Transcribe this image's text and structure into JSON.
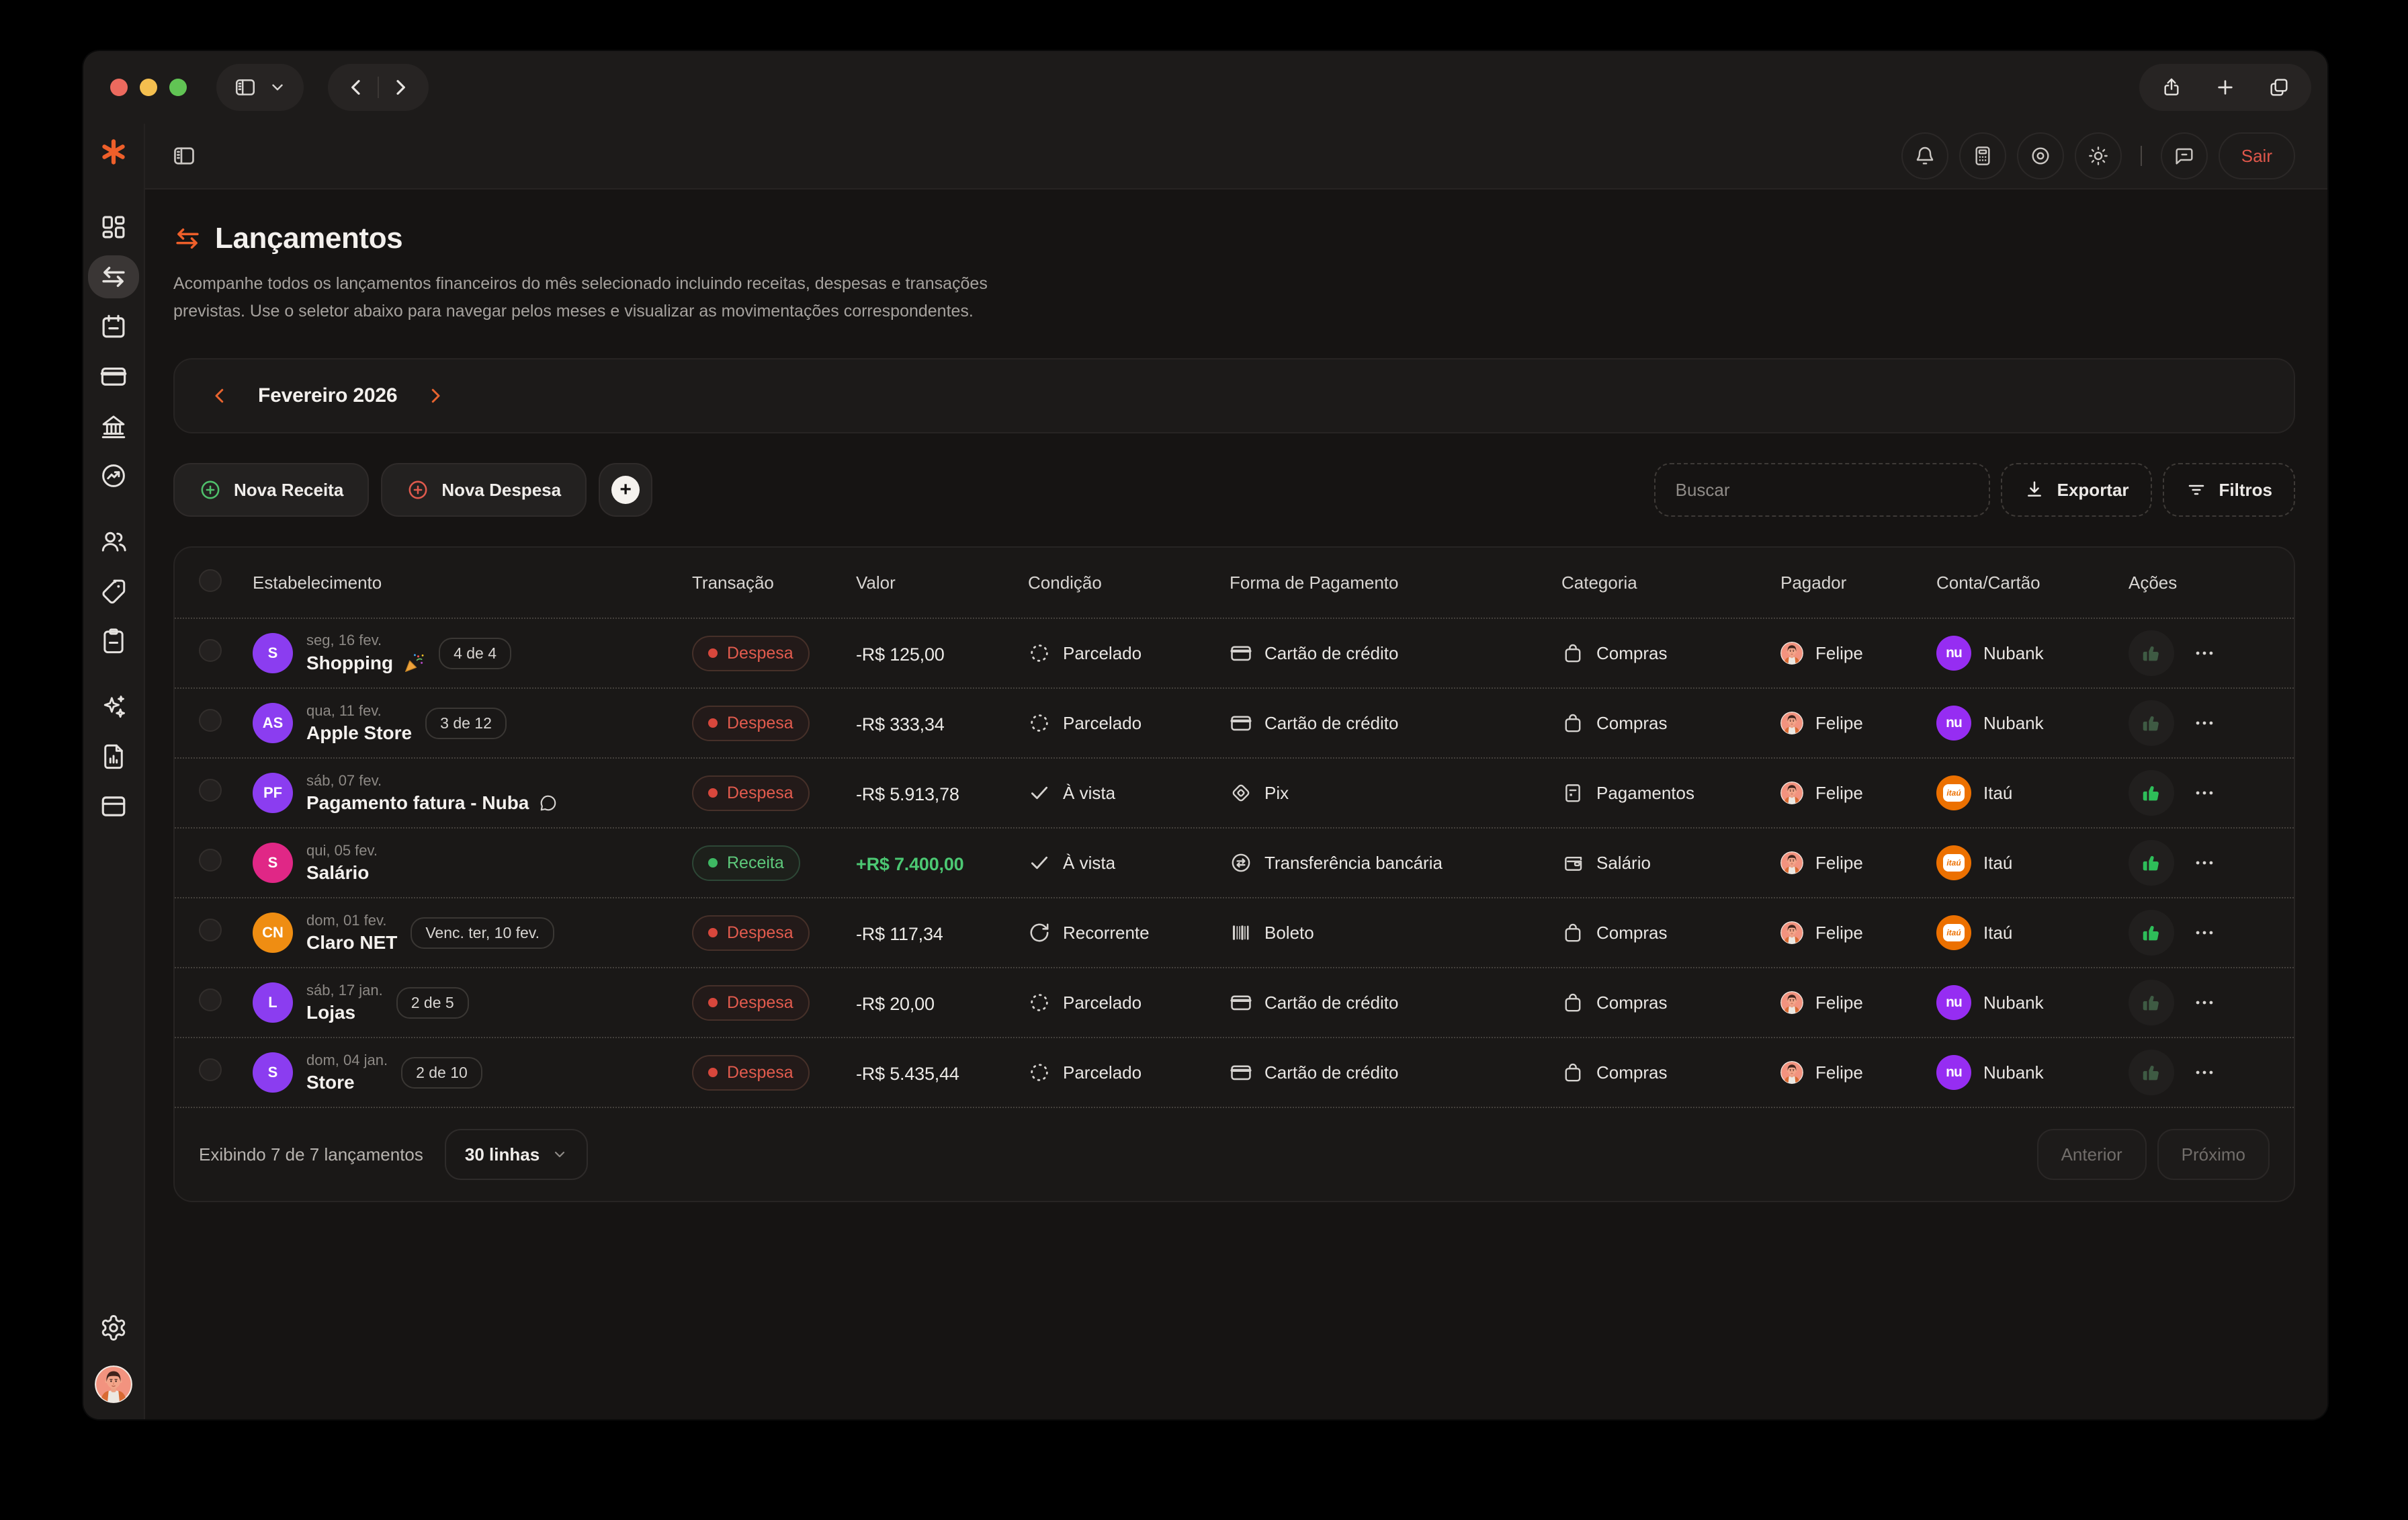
{
  "topbar": {
    "icons": [
      {
        "id": "notifications",
        "icon": "bell"
      },
      {
        "id": "calculator",
        "icon": "calculator"
      },
      {
        "id": "visibility",
        "icon": "eye"
      },
      {
        "id": "theme",
        "icon": "sun"
      },
      {
        "id": "divider"
      },
      {
        "id": "feedback",
        "icon": "message"
      }
    ],
    "logout_label": "Sair"
  },
  "sidebar": {
    "logo_icon": "asterisk-logo",
    "items": [
      {
        "id": "dashboard",
        "icon": "layout-dashboard",
        "active": false
      },
      {
        "id": "transactions",
        "icon": "transfer-arrows",
        "active": true
      },
      {
        "id": "calendar",
        "icon": "calendar",
        "active": false
      },
      {
        "id": "cards",
        "icon": "credit-card",
        "active": false
      },
      {
        "id": "bank-accounts",
        "icon": "bank",
        "active": false
      },
      {
        "id": "performance",
        "icon": "trend-circle",
        "active": false
      },
      {
        "id": "members",
        "icon": "users",
        "active": false,
        "new_group": true
      },
      {
        "id": "tags",
        "icon": "tag",
        "active": false
      },
      {
        "id": "planner",
        "icon": "clipboard",
        "active": false
      },
      {
        "id": "ai-assistant",
        "icon": "sparkles",
        "active": false,
        "new_group": true
      },
      {
        "id": "reports",
        "icon": "file-chart",
        "active": false
      },
      {
        "id": "browser",
        "icon": "window",
        "active": false
      }
    ],
    "bottom": [
      {
        "id": "settings",
        "icon": "gear"
      },
      {
        "id": "profile",
        "icon": "user-avatar"
      }
    ]
  },
  "header": {
    "title": "Lançamentos",
    "title_icon": "transfer-arrows",
    "description": "Acompanhe todos os lançamentos financeiros do mês selecionado incluindo receitas, despesas e transações previstas. Use o seletor abaixo para navegar pelos meses e visualizar as movimentações correspondentes."
  },
  "month_selector": {
    "label": "Fevereiro 2026",
    "prev_icon": "chevron-left",
    "next_icon": "chevron-right"
  },
  "actions": {
    "new_income_label": "Nova Receita",
    "new_expense_label": "Nova Despesa",
    "add_label": "+",
    "search_placeholder": "Buscar",
    "export_label": "Exportar",
    "filters_label": "Filtros"
  },
  "table": {
    "columns": [
      "Estabelecimento",
      "Transação",
      "Valor",
      "Condição",
      "Forma de Pagamento",
      "Categoria",
      "Pagador",
      "Conta/Cartão",
      "Ações"
    ],
    "rows": [
      {
        "initials": "S",
        "avatar_color": "#8b3df0",
        "date": "seg, 16 fev.",
        "name": "Shopping",
        "decorations": [
          "party"
        ],
        "badge": "4 de 4",
        "type": {
          "label": "Despesa",
          "kind": "expense"
        },
        "value": "-R$ 125,00",
        "value_kind": "negative",
        "condition": {
          "label": "Parcelado",
          "icon": "installments"
        },
        "payment": {
          "label": "Cartão de crédito",
          "icon": "credit-card"
        },
        "category": {
          "label": "Compras",
          "icon": "shopping-bag"
        },
        "payer": "Felipe",
        "account": {
          "label": "Nubank",
          "bank": "nubank"
        },
        "paid": false
      },
      {
        "initials": "AS",
        "avatar_color": "#8b3df0",
        "date": "qua, 11 fev.",
        "name": "Apple Store",
        "decorations": [],
        "badge": "3 de 12",
        "type": {
          "label": "Despesa",
          "kind": "expense"
        },
        "value": "-R$ 333,34",
        "value_kind": "negative",
        "condition": {
          "label": "Parcelado",
          "icon": "installments"
        },
        "payment": {
          "label": "Cartão de crédito",
          "icon": "credit-card"
        },
        "category": {
          "label": "Compras",
          "icon": "shopping-bag"
        },
        "payer": "Felipe",
        "account": {
          "label": "Nubank",
          "bank": "nubank"
        },
        "paid": false
      },
      {
        "initials": "PF",
        "avatar_color": "#8b3df0",
        "date": "sáb, 07 fev.",
        "name": "Pagamento fatura - Nuba",
        "decorations": [
          "comment"
        ],
        "badge": null,
        "type": {
          "label": "Despesa",
          "kind": "expense"
        },
        "value": "-R$ 5.913,78",
        "value_kind": "negative",
        "condition": {
          "label": "À vista",
          "icon": "check"
        },
        "payment": {
          "label": "Pix",
          "icon": "pix"
        },
        "category": {
          "label": "Pagamentos",
          "icon": "receipt"
        },
        "payer": "Felipe",
        "account": {
          "label": "Itaú",
          "bank": "itau"
        },
        "paid": true
      },
      {
        "initials": "S",
        "avatar_color": "#e02786",
        "date": "qui, 05 fev.",
        "name": "Salário",
        "decorations": [],
        "badge": null,
        "type": {
          "label": "Receita",
          "kind": "income"
        },
        "value": "+R$ 7.400,00",
        "value_kind": "positive",
        "condition": {
          "label": "À vista",
          "icon": "check"
        },
        "payment": {
          "label": "Transferência bancária",
          "icon": "bank-transfer"
        },
        "category": {
          "label": "Salário",
          "icon": "wallet"
        },
        "payer": "Felipe",
        "account": {
          "label": "Itaú",
          "bank": "itau"
        },
        "paid": true
      },
      {
        "initials": "CN",
        "avatar_color": "#ef8d12",
        "date": "dom, 01 fev.",
        "name": "Claro NET",
        "decorations": [],
        "badge": "Venc. ter, 10 fev.",
        "type": {
          "label": "Despesa",
          "kind": "expense"
        },
        "value": "-R$ 117,34",
        "value_kind": "negative",
        "condition": {
          "label": "Recorrente",
          "icon": "recurring"
        },
        "payment": {
          "label": "Boleto",
          "icon": "barcode"
        },
        "category": {
          "label": "Compras",
          "icon": "shopping-bag"
        },
        "payer": "Felipe",
        "account": {
          "label": "Itaú",
          "bank": "itau"
        },
        "paid": true
      },
      {
        "initials": "L",
        "avatar_color": "#8b3df0",
        "date": "sáb, 17 jan.",
        "name": "Lojas",
        "decorations": [],
        "badge": "2 de 5",
        "type": {
          "label": "Despesa",
          "kind": "expense"
        },
        "value": "-R$ 20,00",
        "value_kind": "negative",
        "condition": {
          "label": "Parcelado",
          "icon": "installments"
        },
        "payment": {
          "label": "Cartão de crédito",
          "icon": "credit-card"
        },
        "category": {
          "label": "Compras",
          "icon": "shopping-bag"
        },
        "payer": "Felipe",
        "account": {
          "label": "Nubank",
          "bank": "nubank"
        },
        "paid": false
      },
      {
        "initials": "S",
        "avatar_color": "#8b3df0",
        "date": "dom, 04 jan.",
        "name": "Store",
        "decorations": [],
        "badge": "2 de 10",
        "type": {
          "label": "Despesa",
          "kind": "expense"
        },
        "value": "-R$ 5.435,44",
        "value_kind": "negative",
        "condition": {
          "label": "Parcelado",
          "icon": "installments"
        },
        "payment": {
          "label": "Cartão de crédito",
          "icon": "credit-card"
        },
        "category": {
          "label": "Compras",
          "icon": "shopping-bag"
        },
        "payer": "Felipe",
        "account": {
          "label": "Nubank",
          "bank": "nubank"
        },
        "paid": false
      }
    ]
  },
  "footer": {
    "summary": "Exibindo 7 de 7 lançamentos",
    "rows_per_page": "30 linhas",
    "prev_label": "Anterior",
    "next_label": "Próximo"
  },
  "banks": {
    "nubank_label": "nu",
    "itau_label": "itaú"
  },
  "colors": {
    "accent": "#ee5f2a",
    "expense": "#e25b4e",
    "income": "#5ec97b",
    "amount_positive": "#4cc873",
    "avatar_purple": "#8b3df0",
    "avatar_pink": "#e02786",
    "avatar_orange": "#ef8d12",
    "nubank": "#962df2",
    "itau": "#ec7000",
    "thumb_active": "#2ebd59",
    "thumb_inactive": "#3e5a43"
  }
}
